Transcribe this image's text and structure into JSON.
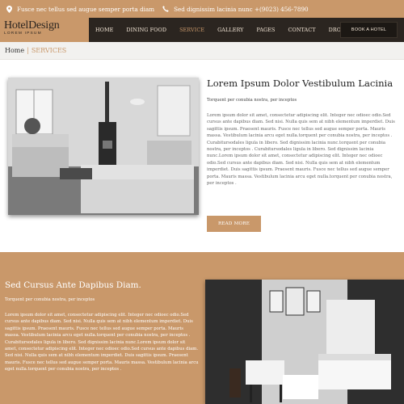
{
  "topbar": {
    "address": "Fusce nec tellus sed augue semper porta diam",
    "phone": "Sed dignissim lacinia nunc +(9023) 456-7890",
    "icon_address": "map-pin-icon",
    "icon_phone": "phone-icon"
  },
  "brand": {
    "name": "HotelDesign",
    "tagline": "LOREM IPSUM"
  },
  "nav": {
    "items": [
      {
        "label": "HOME"
      },
      {
        "label": "DINING FOOD"
      },
      {
        "label": "SERVICE"
      },
      {
        "label": "GALLERY"
      },
      {
        "label": "PAGES"
      },
      {
        "label": "CONTACT"
      },
      {
        "label": "DROPDOWN"
      }
    ],
    "active": "SERVICE",
    "book_label": "BOOK A HOTEL"
  },
  "breadcrumb": {
    "home": "Home",
    "separator": "|",
    "current": "SERVICES"
  },
  "section1": {
    "title": "Lorem Ipsum Dolor Vestibulum Lacinia",
    "subtitle": "Torquent per conubia nostra, per inceptos",
    "body": "Lorem ipsum dolor sit amet, consectetur adipiscing elit. Integer nec odioec odio.Sed cursus ante dapibus diam. Sed nisi. Nulla quis sem at nibh elementum imperdiet. Duis sagittis ipsum. Praesent mauris. Fusce nec tellus sed augue semper porta. Mauris massa. Vestibulum lacinia arcu eget nulla.torquent per conubia nostra, per inceptos . Curabitursodales ligula in libero. Sed dignissim lacinia nunc.torquent per conubia nostra, per inceptos . Curabitursodales ligula in libero. Sed dignissim lacinia nunc.Lorem ipsum dolor sit amet, consectetur adipiscing elit. Integer nec odioec odio.Sed cursus ante dapibus diam. Sed nisi. Nulla quis sem at nibh elementum imperdiet. Duis sagittis ipsum. Praesent mauris. Fusce nec tellus sed augue semper porta. Mauris massa. Vestibulum lacinia arcu eget nulla.torquent per conubia nostra, per inceptos .",
    "button": "READ MORE"
  },
  "section2": {
    "title": "Sed Cursus Ante Dapibus Diam.",
    "subtitle": "Torquent per conubia nostra, per inceptos",
    "body": "Lorem ipsum dolor sit amet, consectetur adipiscing elit. Integer nec odioec odio.Sed cursus ante dapibus diam. Sed nisi. Nulla quis sem at nibh elementum imperdiet. Duis sagittis ipsum. Praesent mauris. Fusce nec tellus sed augue semper porta. Mauris massa. Vestibulum lacinia arcu eget nulla.torquent per conubia nostra, per inceptos . Curabitursodales ligula in libero. Sed dignissim lacinia nunc.Lorem ipsum dolor sit amet, consectetur adipiscing elit. Integer nec odioec odio.Sed cursus ante dapibus diam. Sed nisi. Nulla quis sem at nibh elementum imperdiet. Duis sagittis ipsum. Praesent mauris. Fusce nec tellus sed augue semper porta. Mauris massa. Vestibulum lacinia arcu eget nulla.torquent per conubia nostra, per inceptos ."
  },
  "colors": {
    "accent": "#c9986a",
    "nav_bg": "#2b2520"
  }
}
